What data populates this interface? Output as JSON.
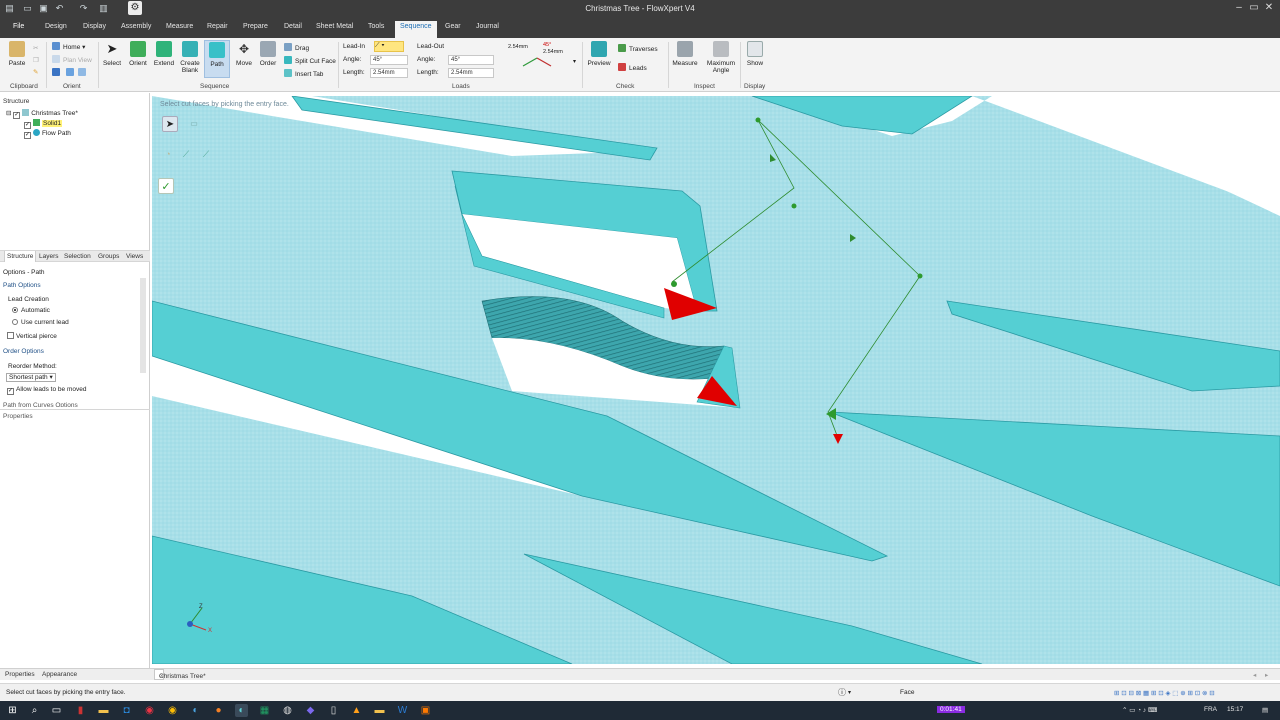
{
  "window": {
    "title": "Christmas Tree - FlowXpert V4"
  },
  "menu": {
    "file": "File",
    "tabs": [
      "Design",
      "Display",
      "Assembly",
      "Measure",
      "Repair",
      "Prepare",
      "Detail",
      "Sheet Metal",
      "Tools",
      "Sequence",
      "Gear",
      "Journal"
    ],
    "active_index": 9
  },
  "ribbon": {
    "clipboard": {
      "paste": "Paste",
      "group": "Clipboard"
    },
    "orient": {
      "home": "Home",
      "plan_view": "Plan View",
      "group": "Orient"
    },
    "sequence": {
      "buttons": [
        "Select",
        "Orient",
        "Extend",
        "Create Blank",
        "Path",
        "Move",
        "Order"
      ],
      "small": [
        "Drag",
        "Split Cut Face",
        "Insert Tab"
      ],
      "group": "Sequence"
    },
    "leadin": {
      "label": "Lead-In",
      "angle_label": "Angle:",
      "angle": "45°",
      "length_label": "Length:",
      "length": "2.54mm"
    },
    "leadout": {
      "label": "Lead-Out",
      "angle_label": "Angle:",
      "angle": "45°",
      "length_label": "Length:",
      "length": "2.54mm"
    },
    "preview_values": {
      "a": "2.54mm",
      "b": "2.54mm",
      "angle": "45°"
    },
    "loads_group": "Loads",
    "check": {
      "preview": "Preview",
      "traverses": "Traverses",
      "leads": "Leads",
      "group": "Check"
    },
    "inspect": {
      "measure": "Measure",
      "max_angle": "Maximum Angle",
      "group": "Inspect"
    },
    "display": {
      "show": "Show",
      "group": "Display"
    }
  },
  "structure": {
    "header": "Structure",
    "root": "Christmas Tree*",
    "items": [
      "Solid1",
      "Flow Path"
    ]
  },
  "panel_tabs": [
    "Structure",
    "Layers",
    "Selection",
    "Groups",
    "Views"
  ],
  "options": {
    "header": "Options - Path",
    "path_options": "Path Options",
    "lead_creation": "Lead Creation",
    "automatic": "Automatic",
    "use_current_lead": "Use current lead",
    "vertical_pierce": "Vertical pierce",
    "order_options": "Order Options",
    "reorder_method": "Reorder Method:",
    "reorder_value": "Shortest path",
    "allow_leads": "Allow leads to be moved",
    "path_from_curves": "Path from Curves Options",
    "properties": "Properties"
  },
  "viewport": {
    "hint": "Select cut faces by picking the entry face.",
    "axis": {
      "x": "X",
      "z": "Z"
    }
  },
  "bottom_tabs": {
    "properties": "Properties",
    "appearance": "Appearance",
    "doc": "Christmas Tree*"
  },
  "status": {
    "message": "Select cut faces by picking the entry face.",
    "face": "Face"
  },
  "taskbar": {
    "lang": "FRA",
    "time": "15:17",
    "recorder": "0:01:41"
  },
  "colors": {
    "part": "#55cfd3",
    "part_dark": "#2a9aa3",
    "background_mesh": "#a9dfe8",
    "accent": "#1e6fb5",
    "path": "#2e8b2e",
    "marker": "#e00000"
  }
}
